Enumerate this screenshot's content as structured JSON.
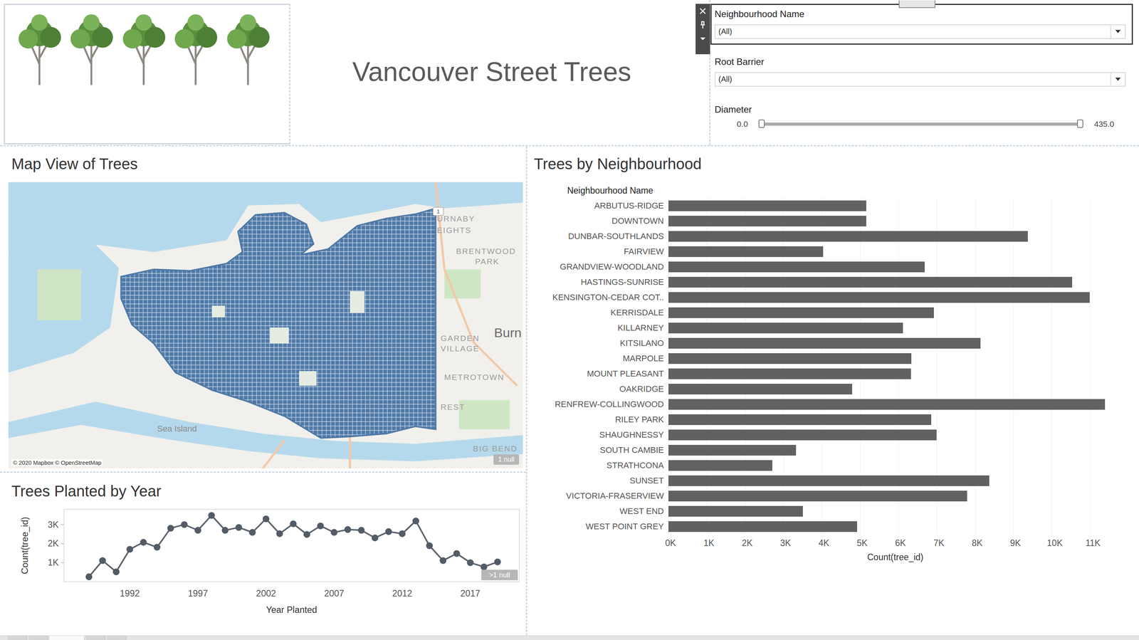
{
  "header": {
    "title": "Vancouver Street Trees"
  },
  "filters": {
    "dropdowns": [
      {
        "label": "Neighbourhood Name",
        "value": "(All)",
        "selected": true
      },
      {
        "label": "Root Barrier",
        "value": "(All)",
        "selected": false
      }
    ],
    "slider": {
      "label": "Diameter",
      "min": "0.0",
      "max": "435.0",
      "level": 1
    }
  },
  "map": {
    "title": "Map View of Trees",
    "labels": [
      {
        "text": "URNABY",
        "kind": "area"
      },
      {
        "text": "EIGHTS",
        "kind": "area"
      },
      {
        "text": "BRENTWOOD",
        "kind": "area"
      },
      {
        "text": "PARK",
        "kind": "area"
      },
      {
        "text": "Burn",
        "kind": "city"
      },
      {
        "text": "GARDEN",
        "kind": "area"
      },
      {
        "text": "VILLAGE",
        "kind": "area"
      },
      {
        "text": "METROTOWN",
        "kind": "area"
      },
      {
        "text": "REST",
        "kind": "area"
      },
      {
        "text": "Sea Island",
        "kind": "island"
      },
      {
        "text": "BIG BEND",
        "kind": "area"
      },
      {
        "text": "1",
        "kind": "shield"
      }
    ],
    "attribution": "© 2020 Mapbox © OpenStreetMap",
    "null_badge": "1 null"
  },
  "year_chart": {
    "title": "Trees Planted by Year",
    "y_axis_title": "Count(tree_id)",
    "y_ticks": [
      "1K",
      "2K",
      "3K"
    ],
    "x_ticks": [
      "1992",
      "1997",
      "2002",
      "2007",
      "2012",
      "2017"
    ],
    "x_axis_title": "Year Planted",
    "null_badge": ">1 null",
    "years": [
      1989,
      1990,
      1991,
      1992,
      1993,
      1994,
      1995,
      1996,
      1997,
      1998,
      1999,
      2000,
      2001,
      2002,
      2003,
      2004,
      2005,
      2006,
      2007,
      2008,
      2009,
      2010,
      2011,
      2012,
      2013,
      2014,
      2015,
      2016,
      2017,
      2018,
      2019
    ],
    "values": [
      260,
      1110,
      520,
      1700,
      2070,
      1810,
      2810,
      3000,
      2700,
      3480,
      2700,
      2850,
      2590,
      3300,
      2520,
      3040,
      2480,
      2930,
      2590,
      2740,
      2700,
      2300,
      2630,
      2520,
      3190,
      1890,
      1110,
      1480,
      1000,
      780,
      1040
    ]
  },
  "bar_chart": {
    "title": "Trees by Neighbourhood",
    "row_header": "Neighbourhood Name",
    "x_ticks": [
      "0K",
      "1K",
      "2K",
      "3K",
      "4K",
      "5K",
      "6K",
      "7K",
      "8K",
      "9K",
      "10K",
      "11K"
    ],
    "x_axis_title": "Count(tree_id)",
    "bars": [
      {
        "label": "ARBUTUS-RIDGE",
        "value": 5160
      },
      {
        "label": "DOWNTOWN",
        "value": 5160
      },
      {
        "label": "DUNBAR-SOUTHLANDS",
        "value": 9380
      },
      {
        "label": "FAIRVIEW",
        "value": 4040
      },
      {
        "label": "GRANDVIEW-WOODLAND",
        "value": 6690
      },
      {
        "label": "HASTINGS-SUNRISE",
        "value": 10530
      },
      {
        "label": "KENSINGTON-CEDAR COT..",
        "value": 10990
      },
      {
        "label": "KERRISDALE",
        "value": 6930
      },
      {
        "label": "KILLARNEY",
        "value": 6120
      },
      {
        "label": "KITSILANO",
        "value": 8140
      },
      {
        "label": "MARPOLE",
        "value": 6340
      },
      {
        "label": "MOUNT PLEASANT",
        "value": 6330
      },
      {
        "label": "OAKRIDGE",
        "value": 4790
      },
      {
        "label": "RENFREW-COLLINGWOOD",
        "value": 11390
      },
      {
        "label": "RILEY PARK",
        "value": 6860
      },
      {
        "label": "SHAUGHNESSY",
        "value": 7000
      },
      {
        "label": "SOUTH CAMBIE",
        "value": 3330
      },
      {
        "label": "STRATHCONA",
        "value": 2710
      },
      {
        "label": "SUNSET",
        "value": 8370
      },
      {
        "label": "VICTORIA-FRASERVIEW",
        "value": 7790
      },
      {
        "label": "WEST END",
        "value": 3510
      },
      {
        "label": "WEST POINT GREY",
        "value": 4920
      }
    ]
  }
}
